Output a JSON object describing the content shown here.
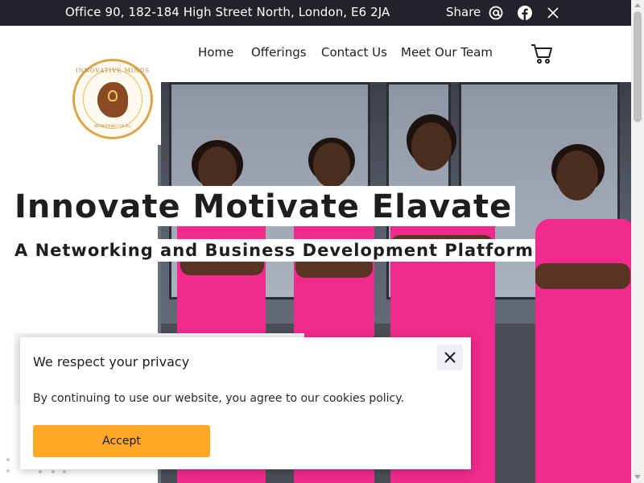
{
  "topbar": {
    "address": "Office 90, 182-184 High Street North, London, E6 2JA",
    "share_label": "Share",
    "social_icons": [
      "email-at-icon",
      "facebook-icon",
      "x-icon"
    ]
  },
  "nav": {
    "items": [
      {
        "label": "Home"
      },
      {
        "label": "Offerings"
      },
      {
        "label": "Contact Us"
      },
      {
        "label": "Meet Our Team"
      }
    ],
    "cart_icon": "cart-icon"
  },
  "logo": {
    "ring_text": "INNOVATIVE MINDS",
    "sub_text": "NETWORKING FOR ALL"
  },
  "hero": {
    "headline": "Innovate Motivate Elavate",
    "subheadline": "A Networking and Business Development Platform"
  },
  "cookie": {
    "title": "We respect your privacy",
    "text": "By continuing to use our website, you agree to our cookies policy.",
    "accept_label": "Accept",
    "close_icon": "close-icon"
  },
  "colors": {
    "topbar_bg": "#22232a",
    "accent": "#ffa726",
    "dress_pink": "#f12a8e",
    "logo_gold": "#d9a64a"
  }
}
